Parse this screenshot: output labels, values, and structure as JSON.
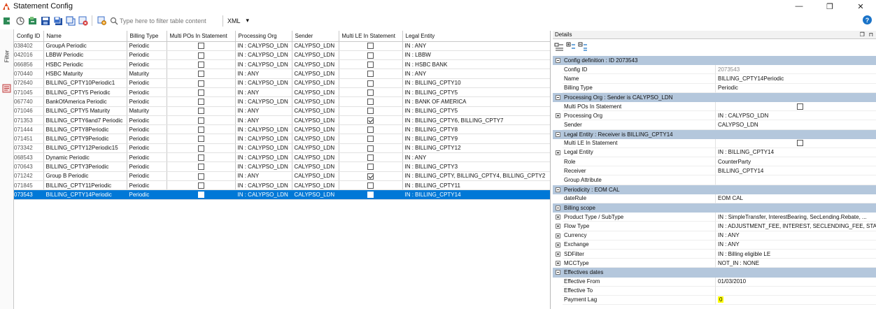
{
  "window": {
    "title": "Statement Config",
    "minimize": "—",
    "maximize": "❐",
    "close": "✕"
  },
  "toolbar": {
    "filter_placeholder": "Type here to filter table content",
    "format_value": "XML",
    "format_caret": "▾",
    "help": "?"
  },
  "side": {
    "filter_tab": "Filter"
  },
  "table": {
    "columns": [
      "Config ID",
      "Name",
      "Billing Type",
      "Multi POs In Statement",
      "Processing Org",
      "Sender",
      "Multi LE In Statement",
      "Legal Entity"
    ],
    "rows": [
      {
        "id": "038402",
        "name": "GroupA Periodic",
        "type": "Periodic",
        "multi_po": false,
        "org": "IN : CALYPSO_LDN",
        "sender": "CALYPSO_LDN",
        "multi_le": false,
        "le": "IN : ANY"
      },
      {
        "id": "042016",
        "name": "LBBW Periodic",
        "type": "Periodic",
        "multi_po": false,
        "org": "IN : CALYPSO_LDN",
        "sender": "CALYPSO_LDN",
        "multi_le": false,
        "le": "IN : LBBW"
      },
      {
        "id": "066856",
        "name": "HSBC Periodic",
        "type": "Periodic",
        "multi_po": false,
        "org": "IN : CALYPSO_LDN",
        "sender": "CALYPSO_LDN",
        "multi_le": false,
        "le": "IN : HSBC BANK"
      },
      {
        "id": "070440",
        "name": "HSBC Maturity",
        "type": "Maturity",
        "multi_po": false,
        "org": "IN : ANY",
        "sender": "CALYPSO_LDN",
        "multi_le": false,
        "le": "IN : ANY"
      },
      {
        "id": "072640",
        "name": "BILLING_CPTY10Periodic1",
        "type": "Periodic",
        "multi_po": false,
        "org": "IN : CALYPSO_LDN",
        "sender": "CALYPSO_LDN",
        "multi_le": false,
        "le": "IN : BILLING_CPTY10"
      },
      {
        "id": "071045",
        "name": "BILLING_CPTY5 Periodic",
        "type": "Periodic",
        "multi_po": false,
        "org": "IN : ANY",
        "sender": "CALYPSO_LDN",
        "multi_le": false,
        "le": "IN : BILLING_CPTY5"
      },
      {
        "id": "067740",
        "name": "BankOfAmerica  Periodic",
        "type": "Periodic",
        "multi_po": false,
        "org": "IN : CALYPSO_LDN",
        "sender": "CALYPSO_LDN",
        "multi_le": false,
        "le": "IN : BANK OF AMERICA"
      },
      {
        "id": "071046",
        "name": "BILLING_CPTY5 Maturity",
        "type": "Maturity",
        "multi_po": false,
        "org": "IN : ANY",
        "sender": "CALYPSO_LDN",
        "multi_le": false,
        "le": "IN : BILLING_CPTY5"
      },
      {
        "id": "071353",
        "name": "BILLING_CPTY6and7 Periodic",
        "type": "Periodic",
        "multi_po": false,
        "org": "IN : ANY",
        "sender": "CALYPSO_LDN",
        "multi_le": true,
        "le": "IN : BILLING_CPTY6, BILLING_CPTY7"
      },
      {
        "id": "071444",
        "name": "BILLING_CPTY8Periodic",
        "type": "Periodic",
        "multi_po": false,
        "org": "IN : CALYPSO_LDN",
        "sender": "CALYPSO_LDN",
        "multi_le": false,
        "le": "IN : BILLING_CPTY8"
      },
      {
        "id": "071451",
        "name": "BILLING_CPTY9Periodic",
        "type": "Periodic",
        "multi_po": false,
        "org": "IN : CALYPSO_LDN",
        "sender": "CALYPSO_LDN",
        "multi_le": false,
        "le": "IN : BILLING_CPTY9"
      },
      {
        "id": "073342",
        "name": "BILLING_CPTY12Periodic15",
        "type": "Periodic",
        "multi_po": false,
        "org": "IN : CALYPSO_LDN",
        "sender": "CALYPSO_LDN",
        "multi_le": false,
        "le": "IN : BILLING_CPTY12"
      },
      {
        "id": "068543",
        "name": "Dynamic Periodic",
        "type": "Periodic",
        "multi_po": false,
        "org": "IN : CALYPSO_LDN",
        "sender": "CALYPSO_LDN",
        "multi_le": false,
        "le": "IN : ANY"
      },
      {
        "id": "070643",
        "name": "BILLING_CPTY3Periodic",
        "type": "Periodic",
        "multi_po": false,
        "org": "IN : CALYPSO_LDN",
        "sender": "CALYPSO_LDN",
        "multi_le": false,
        "le": "IN : BILLING_CPTY3"
      },
      {
        "id": "071242",
        "name": "Group B Periodic",
        "type": "Periodic",
        "multi_po": false,
        "org": "IN : ANY",
        "sender": "CALYPSO_LDN",
        "multi_le": true,
        "le": "IN : BILLING_CPTY, BILLING_CPTY4, BILLING_CPTY2"
      },
      {
        "id": "071845",
        "name": "BILLING_CPTY11Periodic",
        "type": "Periodic",
        "multi_po": false,
        "org": "IN : CALYPSO_LDN",
        "sender": "CALYPSO_LDN",
        "multi_le": false,
        "le": "IN : BILLING_CPTY11"
      },
      {
        "id": "073543",
        "name": "BILLING_CPTY14Periodic",
        "type": "Periodic",
        "multi_po": false,
        "org": "IN : CALYPSO_LDN",
        "sender": "CALYPSO_LDN",
        "multi_le": false,
        "le": "IN : BILLING_CPTY14",
        "selected": true
      }
    ]
  },
  "details": {
    "title": "Details",
    "float_btn": "❐",
    "pin_btn": "⊓",
    "rows": [
      {
        "kind": "cat",
        "label": "Config definition : ID 2073543"
      },
      {
        "kind": "prop",
        "name": "Config ID",
        "value": "2073543",
        "grey": true
      },
      {
        "kind": "prop",
        "name": "Name",
        "value": "BILLING_CPTY14Periodic"
      },
      {
        "kind": "prop",
        "name": "Billing Type",
        "value": "Periodic"
      },
      {
        "kind": "cat",
        "label": "Processing Org : Sender is CALYPSO_LDN"
      },
      {
        "kind": "prop",
        "name": "Multi POs In Statement",
        "checkbox": true
      },
      {
        "kind": "prop",
        "name": "Processing Org",
        "value": "IN : CALYPSO_LDN",
        "expand": true
      },
      {
        "kind": "prop",
        "name": "Sender",
        "value": "CALYPSO_LDN"
      },
      {
        "kind": "cat",
        "label": "Legal Entity : Receiver is BILLING_CPTY14"
      },
      {
        "kind": "prop",
        "name": "Multi LE In Statement",
        "checkbox": true
      },
      {
        "kind": "prop",
        "name": "Legal Entity",
        "value": "IN : BILLING_CPTY14",
        "expand": true
      },
      {
        "kind": "prop",
        "name": "Role",
        "value": "CounterParty"
      },
      {
        "kind": "prop",
        "name": "Receiver",
        "value": "BILLING_CPTY14"
      },
      {
        "kind": "prop",
        "name": "Group Attribute",
        "value": ""
      },
      {
        "kind": "cat",
        "label": "Periodicity : EOM CAL"
      },
      {
        "kind": "prop",
        "name": "dateRule",
        "value": "EOM CAL"
      },
      {
        "kind": "cat",
        "label": "Billing scope"
      },
      {
        "kind": "prop",
        "name": "Product Type / SubType",
        "value": "IN : SimpleTransfer, InterestBearing, SecLending.Rebate, ...",
        "expand": true
      },
      {
        "kind": "prop",
        "name": "Flow Type",
        "value": "IN : ADJUSTMENT_FEE, INTEREST, SECLENDING_FEE, STAT...",
        "expand": true
      },
      {
        "kind": "prop",
        "name": "Currency",
        "value": "IN : ANY",
        "expand": true
      },
      {
        "kind": "prop",
        "name": "Exchange",
        "value": "IN : ANY",
        "expand": true
      },
      {
        "kind": "prop",
        "name": "SDFilter",
        "value": "IN : Billing eligible LE",
        "expand": true
      },
      {
        "kind": "prop",
        "name": "MCCType",
        "value": "NOT_IN : NONE",
        "expand": true
      },
      {
        "kind": "cat",
        "label": "Effectives dates"
      },
      {
        "kind": "prop",
        "name": "Effective From",
        "value": "01/03/2010"
      },
      {
        "kind": "prop",
        "name": "Effective To",
        "value": ""
      },
      {
        "kind": "prop",
        "name": "Payment Lag",
        "value": "0",
        "highlight": true
      }
    ]
  },
  "colors": {
    "selection": "#0078d7",
    "category": "#b4c7dc",
    "highlight": "#ffff00",
    "accent": "#1a73c8"
  }
}
